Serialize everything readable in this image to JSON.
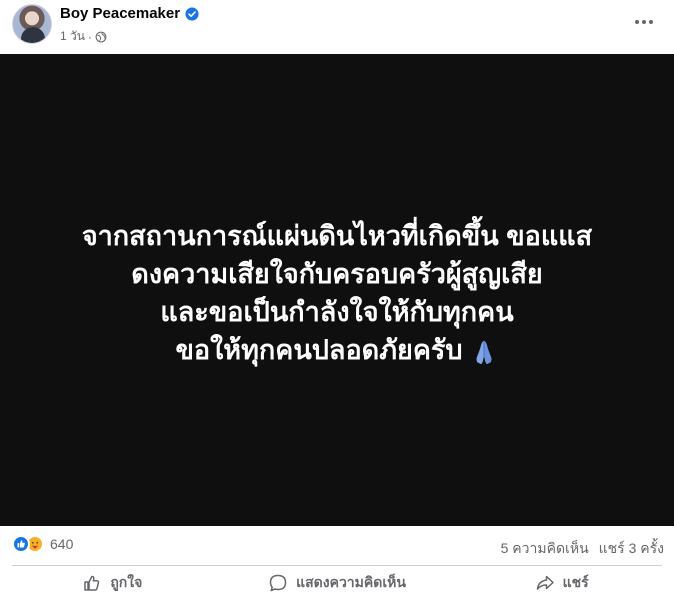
{
  "post": {
    "author": "Boy Peacemaker",
    "time": "1 วัน",
    "separator": "·",
    "text_lines": [
      "จากสถานการณ์แผ่นดินไหวที่เกิดขึ้น ขอแแส",
      "ดงความเสียใจกับครอบครัวผู้สูญเสีย",
      "และขอเป็นกำลังใจให้กับทุกคน",
      "ขอให้ทุกคนปลอดภัยครับ"
    ]
  },
  "stats": {
    "reactions": "640",
    "comments": "5 ความคิดเห็น",
    "shares": "แชร์ 3 ครั้ง"
  },
  "actions": {
    "like": "ถูกใจ",
    "comment": "แสดงความคิดเห็น",
    "share": "แชร์"
  },
  "colors": {
    "accent": "#1b74e4",
    "media_background": "#0f0f10",
    "muted_text": "#65676b"
  }
}
